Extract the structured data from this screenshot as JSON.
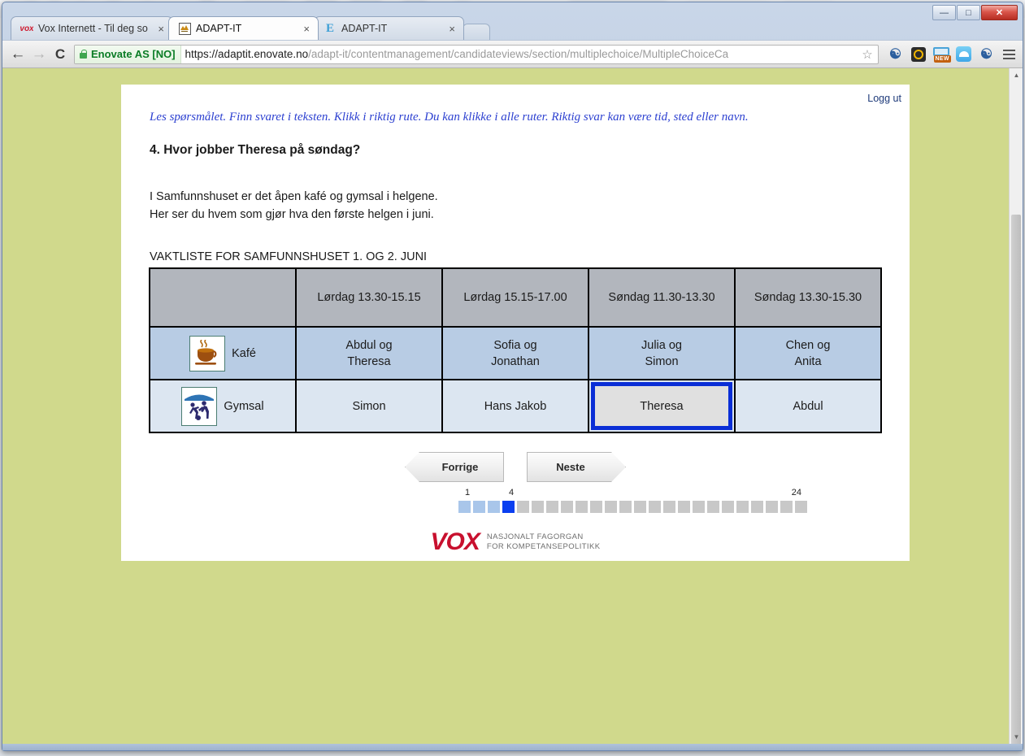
{
  "browser": {
    "tabs": [
      {
        "title": "Vox Internett - Til deg som",
        "favicon": "vox-icon",
        "active": false,
        "close": "×"
      },
      {
        "title": "ADAPT-IT",
        "favicon": "adapt-icon",
        "active": true,
        "close": "×"
      },
      {
        "title": "ADAPT-IT",
        "favicon": "e-icon",
        "active": false,
        "close": "×"
      }
    ],
    "window_controls": {
      "minimize": "—",
      "maximize": "□",
      "close": "✕"
    },
    "nav": {
      "back": "←",
      "forward": "→",
      "reload": "C"
    },
    "omnibox": {
      "security_label": "Enovate AS [NO]",
      "url_scheme_host": "https://adaptit.enovate.no",
      "url_path": "/adapt-it/contentmanagement/candidateviews/section/multiplechoice/MultipleChoiceCa",
      "bookmark_star": "☆"
    },
    "extensions": [
      "person-icon",
      "antivirus-icon",
      "new-badge-icon",
      "cloud-icon",
      "person-icon"
    ],
    "menu": "hamburger-menu-icon"
  },
  "page": {
    "logout_label": "Logg ut",
    "instruction": "Les spørsmålet. Finn svaret i teksten. Klikk i riktig rute. Du kan klikke i alle ruter. Riktig svar kan være tid, sted eller navn.",
    "question": "4. Hvor jobber Theresa på søndag?",
    "passage_line1": "I Samfunnshuset er det åpen kafé og gymsal i helgene.",
    "passage_line2": "Her ser du hvem som gjør hva den første helgen i juni.",
    "table_title": "VAKTLISTE FOR SAMFUNNSHUSET 1. OG 2. JUNI",
    "table": {
      "headers": [
        "",
        "Lørdag 13.30-15.15",
        "Lørdag 15.15-17.00",
        "Søndag 11.30-13.30",
        "Søndag 13.30-15.30"
      ],
      "rows": [
        {
          "label": "Kafé",
          "icon": "coffee-cup-icon",
          "cells": [
            {
              "line1": "Abdul og",
              "line2": "Theresa",
              "selected": false
            },
            {
              "line1": "Sofia og",
              "line2": "Jonathan",
              "selected": false
            },
            {
              "line1": "Julia og",
              "line2": "Simon",
              "selected": false
            },
            {
              "line1": "Chen og",
              "line2": "Anita",
              "selected": false
            }
          ]
        },
        {
          "label": "Gymsal",
          "icon": "gym-sport-icon",
          "cells": [
            {
              "line1": "Simon",
              "line2": "",
              "selected": false
            },
            {
              "line1": "Hans Jakob",
              "line2": "",
              "selected": false
            },
            {
              "line1": "Theresa",
              "line2": "",
              "selected": true
            },
            {
              "line1": "Abdul",
              "line2": "",
              "selected": false
            }
          ]
        }
      ]
    },
    "nav_buttons": {
      "prev": "Forrige",
      "next": "Neste"
    },
    "progress": {
      "start_label": "1",
      "current_label": "4",
      "end_label": "24",
      "total": 24,
      "current": 4,
      "completed": 3
    },
    "footer": {
      "logo_text": "VOX",
      "tagline_line1": "NASJONALT FAGORGAN",
      "tagline_line2": "FOR KOMPETANSEPOLITIKK"
    }
  },
  "colors": {
    "page_background": "#d0d98c",
    "card_background": "#ffffff",
    "instruction_text": "#2b3fd0",
    "table_header": "#b2b6bd",
    "row_kafe": "#b8cce4",
    "row_gym": "#dce6f1",
    "selected_border": "#0a2ed6",
    "selected_fill": "#e0e0e0",
    "progress_done": "#a9c6ea",
    "progress_current": "#0a3ff0",
    "progress_todo": "#c8c8c8",
    "vox_red": "#c8102e",
    "secure_green": "#0a7c25"
  }
}
